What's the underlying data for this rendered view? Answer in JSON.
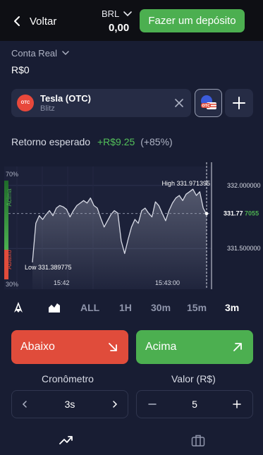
{
  "header": {
    "back_label": "Voltar",
    "currency": "BRL",
    "balance": "0,00",
    "deposit_label": "Fazer um depósito"
  },
  "account": {
    "name": "Conta Real",
    "balance": "R$0"
  },
  "asset": {
    "name": "Tesla (OTC)",
    "provider": "Blitz",
    "logo_text": "OTC"
  },
  "expected_return": {
    "label": "Retorno esperado",
    "amount": "+R$9.25",
    "percent": "(+85%)"
  },
  "chart": {
    "sentiment_top": "70%",
    "sentiment_bottom": "30%",
    "sentiment_up_label": "Acima",
    "sentiment_down_label": "Abaixo",
    "high_label": "High 331.971395",
    "low_label": "Low 331.389775",
    "price_levels": [
      "332.000000",
      "331.500000"
    ],
    "current_price_main": "331.77",
    "current_price_tail": "7055",
    "time_labels": [
      "15:42",
      "15:43:00"
    ],
    "colors": {
      "line": "#d8dbe6",
      "up": "#4caf50",
      "down": "#e04c3b"
    }
  },
  "chart_data": {
    "type": "area",
    "x": [
      "15:41:45",
      "15:41:47",
      "15:41:49",
      "15:41:51",
      "15:41:53",
      "15:41:55",
      "15:41:57",
      "15:41:59",
      "15:42:01",
      "15:42:03",
      "15:42:05",
      "15:42:07",
      "15:42:09",
      "15:42:11",
      "15:42:13",
      "15:42:15",
      "15:42:17",
      "15:42:19",
      "15:42:21",
      "15:42:23",
      "15:42:25",
      "15:42:27",
      "15:42:29",
      "15:42:31",
      "15:42:33",
      "15:42:35",
      "15:42:37",
      "15:42:39",
      "15:42:41",
      "15:42:43",
      "15:42:45",
      "15:42:47",
      "15:42:49",
      "15:42:51",
      "15:42:53",
      "15:42:55",
      "15:42:57",
      "15:42:59",
      "15:43:01",
      "15:43:03",
      "15:43:05",
      "15:43:07",
      "15:43:09",
      "15:43:11",
      "15:43:13",
      "15:43:15",
      "15:43:17",
      "15:43:19",
      "15:43:21",
      "15:43:23",
      "15:43:25",
      "15:43:27"
    ],
    "y": [
      331.39,
      331.7,
      331.76,
      331.73,
      331.77,
      331.8,
      331.76,
      331.82,
      331.84,
      331.83,
      331.81,
      331.75,
      331.8,
      331.84,
      331.86,
      331.88,
      331.86,
      331.9,
      331.84,
      331.82,
      331.74,
      331.67,
      331.72,
      331.77,
      331.8,
      331.78,
      331.56,
      331.46,
      331.57,
      331.67,
      331.73,
      331.7,
      331.8,
      331.82,
      331.78,
      331.75,
      331.87,
      331.84,
      331.78,
      331.72,
      331.8,
      331.86,
      331.9,
      331.92,
      331.88,
      331.93,
      331.95,
      331.97,
      331.92,
      331.95,
      331.82,
      331.77
    ],
    "ylim": [
      331.3,
      332.15
    ],
    "high": 331.971395,
    "low": 331.389775,
    "current": 331.777055,
    "sentiment_up_percent": 70,
    "sentiment_down_percent": 30
  },
  "timeframes": [
    {
      "label": "ALL",
      "active": false
    },
    {
      "label": "1H",
      "active": false
    },
    {
      "label": "30m",
      "active": false
    },
    {
      "label": "15m",
      "active": false
    },
    {
      "label": "3m",
      "active": true
    }
  ],
  "trade": {
    "down_label": "Abaixo",
    "up_label": "Acima",
    "timer_label": "Cronômetro",
    "timer_value": "3s",
    "amount_label": "Valor (R$)",
    "amount_value": "5"
  },
  "icons": {
    "back": "chevron-left-icon",
    "currency_dropdown": "chevron-down-icon",
    "account_dropdown": "chevron-down-icon",
    "remove_asset": "close-icon",
    "otc_switch": "otc-flag-icon",
    "add_asset": "plus-icon",
    "drawing_tool": "drawing-tool-icon",
    "chart_type": "area-chart-icon",
    "down_arrow": "arrow-down-right-icon",
    "up_arrow": "arrow-up-right-icon",
    "nav_trade": "trend-icon",
    "nav_portfolio": "briefcase-icon"
  }
}
